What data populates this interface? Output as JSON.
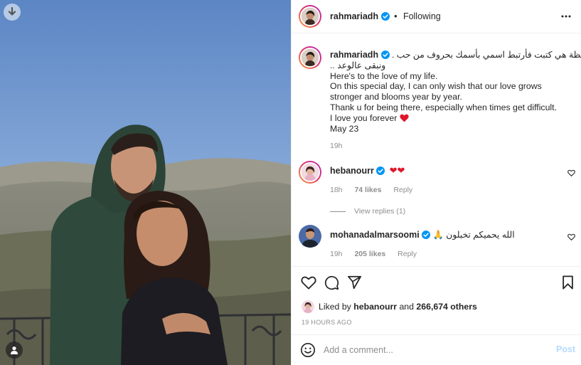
{
  "post": {
    "author": "rahmariadh",
    "follow_status": "Following",
    "separator": "•",
    "caption": {
      "arabic_1": "لحظة هي كتبت فأرتبط اسمي بأسمك بحروف من حب .",
      "arabic_2": "ونبقى عالوعد ..",
      "line_1": "Here's to the love of my life.",
      "line_2": "On this special day, I can only wish that our love grows stronger and blooms year by year.",
      "line_3": "Thank u for being there, especially when times get difficult.",
      "line_4": "I love you forever",
      "line_5": "May 23",
      "time": "19h"
    },
    "comments": [
      {
        "user": "hebanourr",
        "text": "❤❤",
        "time": "18h",
        "likes": "74 likes",
        "reply": "Reply",
        "view_replies": "View replies (1)"
      },
      {
        "user": "mohanadalmarsoomi",
        "text": "الله يحميكم تخبلون 🙏",
        "time": "19h",
        "likes": "205 likes",
        "reply": "Reply"
      }
    ],
    "liked_by": {
      "prefix": "Liked by",
      "user": "hebanourr",
      "and": "and",
      "others": "266,674 others"
    },
    "timestamp": "19 HOURS AGO",
    "compose": {
      "placeholder": "Add a comment...",
      "post_label": "Post"
    }
  },
  "colors": {
    "accent_blue": "#0095f6",
    "post_disabled": "#b3dbff",
    "heart_red": "#ed4956",
    "muted_text": "#8e8e8e"
  },
  "icons": [
    "download-icon",
    "tag-user-icon",
    "verified-badge-icon",
    "more-options-icon",
    "heart-icon",
    "comment-icon",
    "share-icon",
    "save-icon",
    "emoji-icon"
  ]
}
